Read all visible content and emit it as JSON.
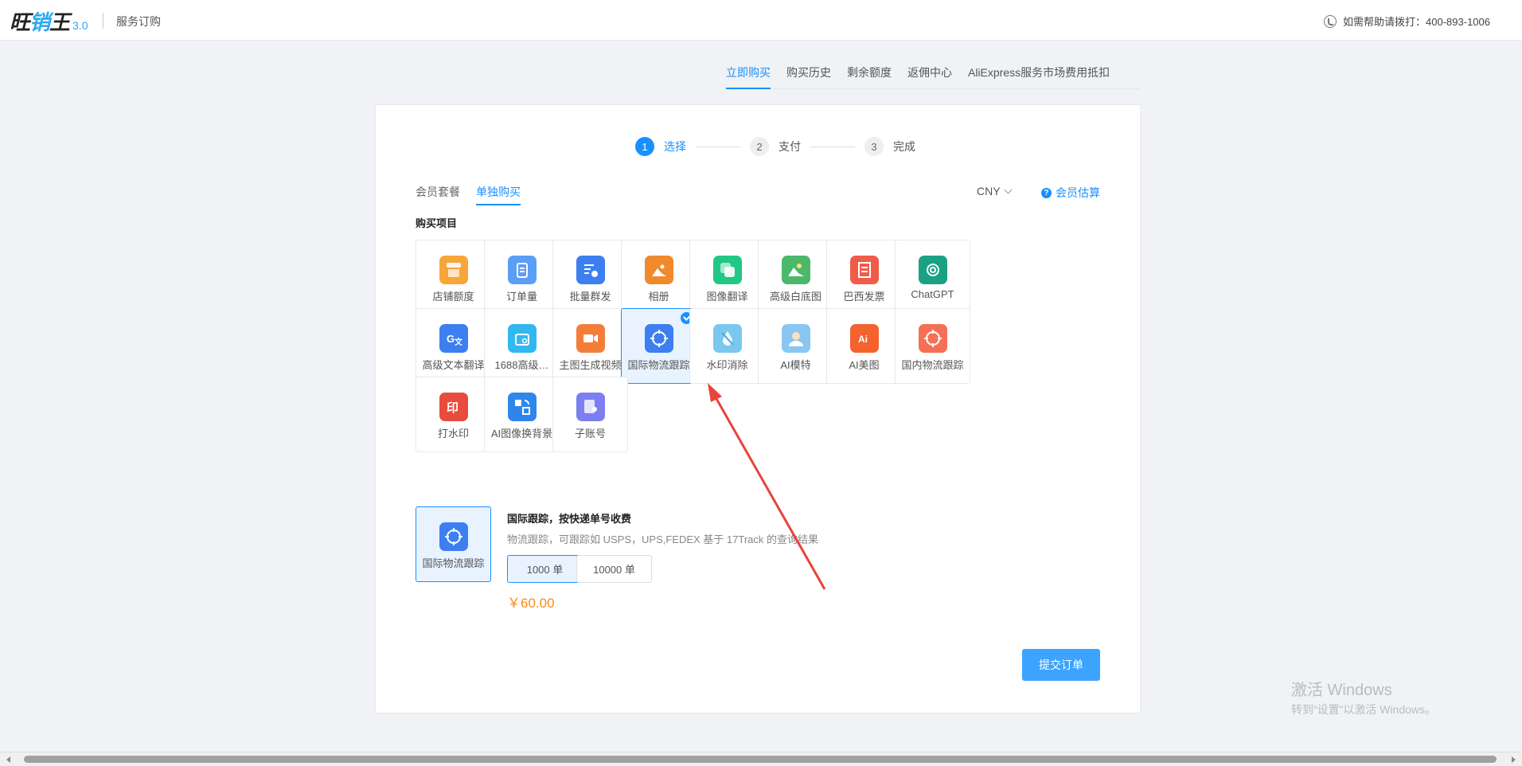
{
  "header": {
    "logo_main": "旺销王",
    "logo_version": "3.0",
    "app_title": "服务订购",
    "help_text": "如需帮助请拨打：400-893-1006"
  },
  "top_tabs": [
    {
      "label": "立即购买",
      "active": true
    },
    {
      "label": "购买历史",
      "active": false
    },
    {
      "label": "剩余额度",
      "active": false
    },
    {
      "label": "返佣中心",
      "active": false
    },
    {
      "label": "AliExpress服务市场费用抵扣",
      "active": false
    }
  ],
  "steps": [
    {
      "num": "1",
      "label": "选择"
    },
    {
      "num": "2",
      "label": "支付"
    },
    {
      "num": "3",
      "label": "完成"
    }
  ],
  "sub_tabs": [
    {
      "label": "会员套餐"
    },
    {
      "label": "单独购买"
    }
  ],
  "currency": "CNY",
  "estimate_label": "会员估算",
  "section_title": "购买项目",
  "items": [
    {
      "label": "店铺额度",
      "icon": "store-icon",
      "color": "#f7a63a"
    },
    {
      "label": "订单量",
      "icon": "clipboard-icon",
      "color": "#5b9ef5"
    },
    {
      "label": "批量群发",
      "icon": "broadcast-icon",
      "color": "#3d7ff0"
    },
    {
      "label": "相册",
      "icon": "image-icon",
      "color": "#f08a2c"
    },
    {
      "label": "图像翻译",
      "icon": "layers-icon",
      "color": "#22c784"
    },
    {
      "label": "高级白底图",
      "icon": "landscape-icon",
      "color": "#4cb86a"
    },
    {
      "label": "巴西发票",
      "icon": "invoice-icon",
      "color": "#ef5c4a"
    },
    {
      "label": "ChatGPT",
      "icon": "chatgpt-icon",
      "color": "#1aa184"
    },
    {
      "label": "高级文本翻译",
      "icon": "translate-icon",
      "color": "#3d7ff0"
    },
    {
      "label": "1688高级…",
      "icon": "search-bag-icon",
      "color": "#31b8f0"
    },
    {
      "label": "主图生成视频",
      "icon": "video-icon",
      "color": "#f57d3a"
    },
    {
      "label": "国际物流跟踪",
      "icon": "tracking-icon",
      "color": "#3d7ff0"
    },
    {
      "label": "水印消除",
      "icon": "droplet-off-icon",
      "color": "#7ac8ef"
    },
    {
      "label": "AI模特",
      "icon": "avatar-icon",
      "color": "#89c7f2"
    },
    {
      "label": "AI美图",
      "icon": "ai-icon",
      "color": "#f5622e"
    },
    {
      "label": "国内物流跟踪",
      "icon": "tracking-domestic-icon",
      "color": "#f57055"
    },
    {
      "label": "打水印",
      "icon": "stamp-icon",
      "color": "#e84c3d"
    },
    {
      "label": "AI图像换背景",
      "icon": "swap-icon",
      "color": "#2f86ea"
    },
    {
      "label": "子账号",
      "icon": "sub-account-icon",
      "color": "#7b7ff0"
    }
  ],
  "selected_index": 11,
  "detail": {
    "tile_label": "国际物流跟踪",
    "title": "国际跟踪，按快递单号收费",
    "desc": "物流跟踪，可跟踪如 USPS，UPS,FEDEX 基于 17Track 的查询结果",
    "options": [
      "1000 单",
      "10000 单"
    ],
    "selected_option": 0,
    "price": "￥60.00"
  },
  "submit_label": "提交订单",
  "watermark": {
    "title": "激活 Windows",
    "sub": "转到“设置”以激活 Windows。"
  }
}
